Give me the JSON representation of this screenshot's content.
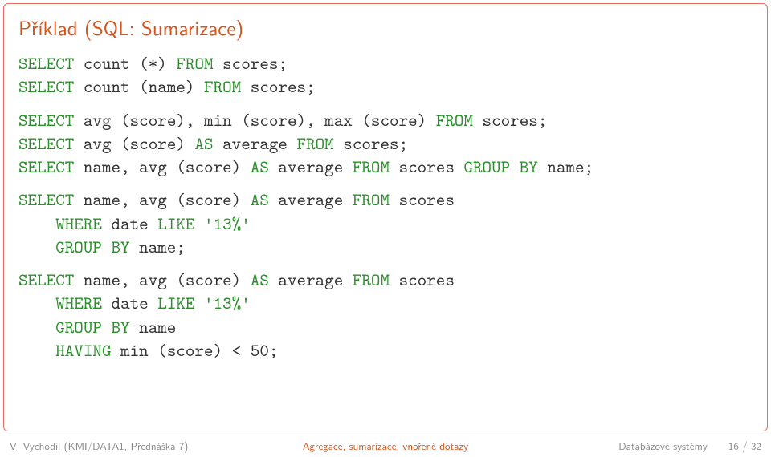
{
  "title": "Příklad (SQL: Sumarizace)",
  "sql": {
    "q1": {
      "select": "SELECT",
      "body1": " count (*) ",
      "from1": "FROM",
      "tail1": " scores;",
      "select2": "SELECT",
      "body2": " count (name) ",
      "from2": "FROM",
      "tail2": " scores;"
    },
    "q2": {
      "select1": "SELECT",
      "body1": " avg (score), min (score), max (score) ",
      "from1": "FROM",
      "tail1": " scores;",
      "select2": "SELECT",
      "body2": " avg (score) ",
      "as2": "AS",
      "body2b": " average ",
      "from2": "FROM",
      "tail2": " scores;",
      "select3": "SELECT",
      "body3": " name, avg (score) ",
      "as3": "AS",
      "body3b": " average ",
      "from3": "FROM",
      "tail3": " scores ",
      "group3": "GROUP BY",
      "tail3b": " name;"
    },
    "q3": {
      "select": "SELECT",
      "body": " name, avg (score) ",
      "as": "AS",
      "bodyb": " average ",
      "from": "FROM",
      "tail": " scores",
      "indent": "    ",
      "where": "WHERE",
      "whbody": " date ",
      "like": "LIKE",
      "whtail1": " ",
      "str": "'13%'",
      "group": "GROUP BY",
      "grouptail": " name;"
    },
    "q4": {
      "select": "SELECT",
      "body": " name, avg (score) ",
      "as": "AS",
      "bodyb": " average ",
      "from": "FROM",
      "tail": " scores",
      "indent": "    ",
      "where": "WHERE",
      "whbody": " date ",
      "like": "LIKE",
      "whtail1": " ",
      "str": "'13%'",
      "group": "GROUP BY",
      "grouptail": " name",
      "having": "HAVING",
      "havtail": " min (score) < 50;"
    }
  },
  "footer": {
    "author": "V. Vychodil (KMI/DATA1, Přednáška 7)",
    "center": "Agregace, sumarizace, vnořené dotazy",
    "right_label": "Databázové systémy",
    "page": "16 / 32"
  }
}
